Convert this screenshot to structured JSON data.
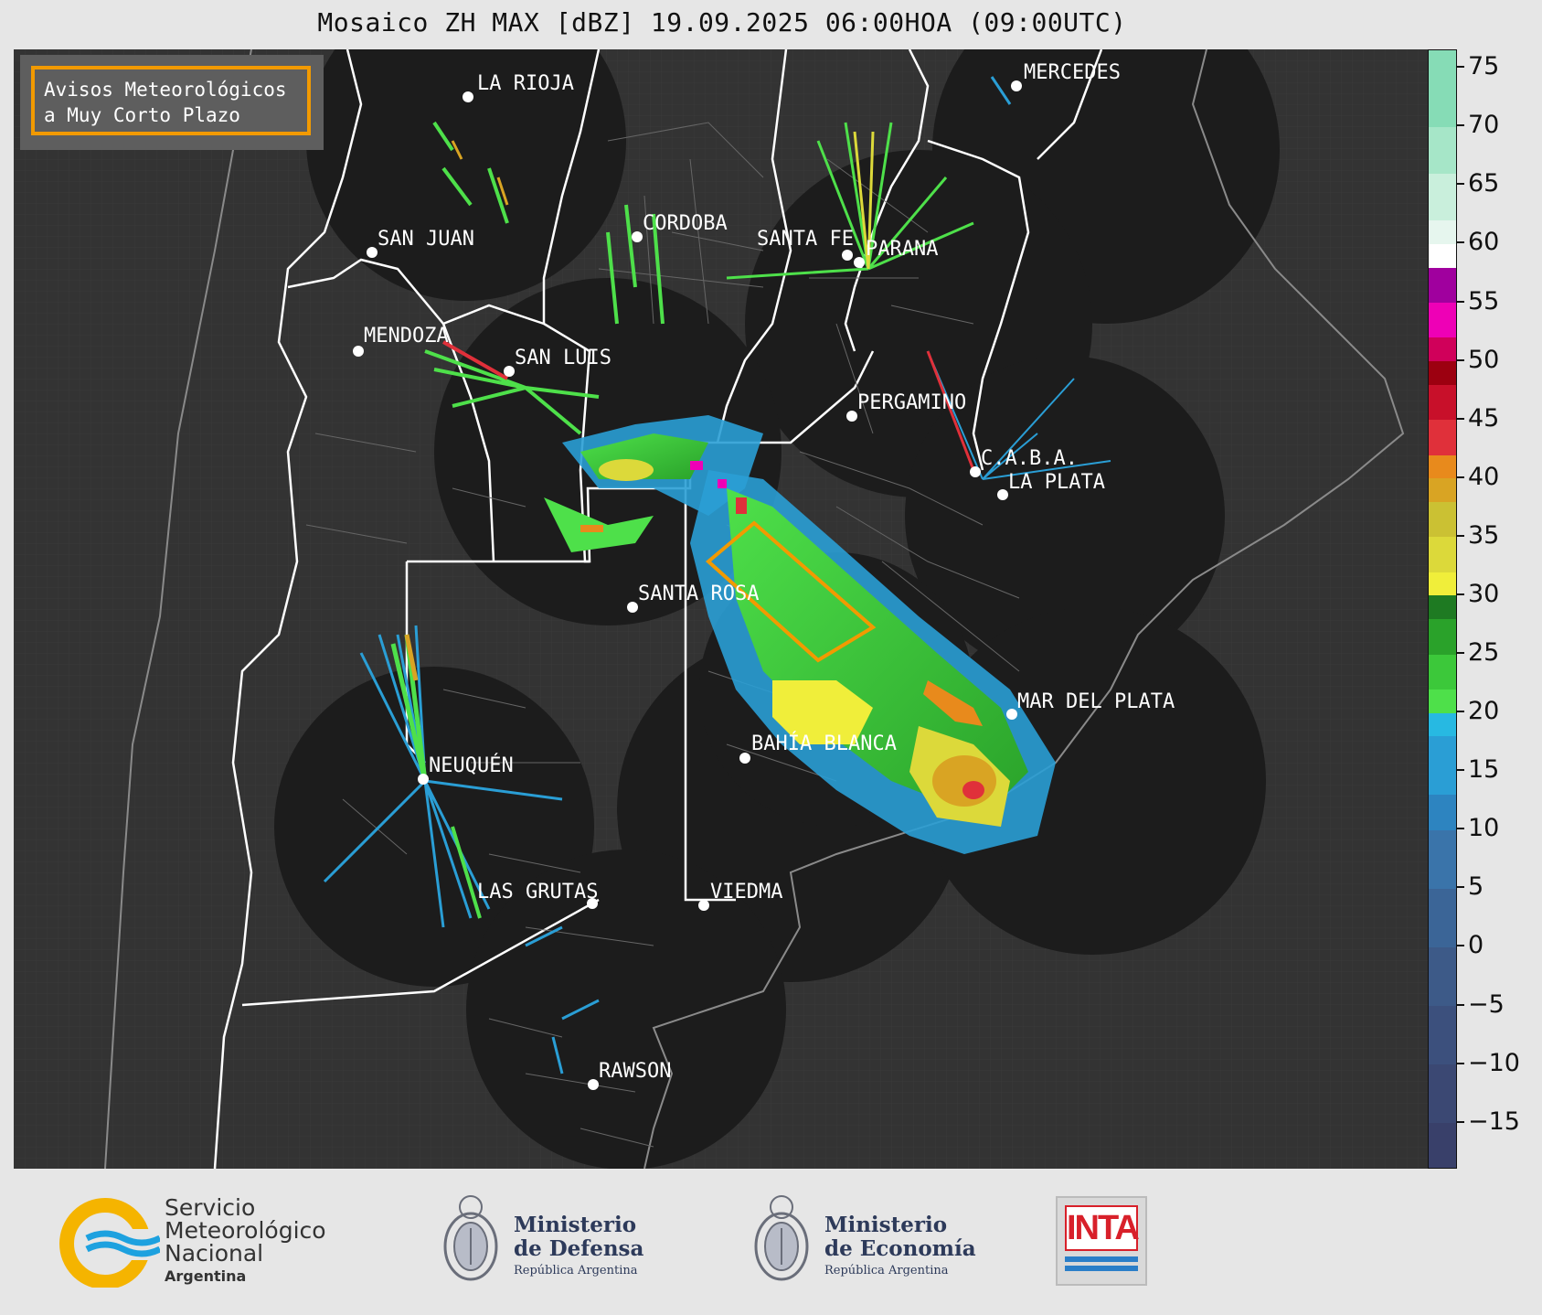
{
  "title": "Mosaico ZH MAX [dBZ] 19.09.2025 06:00HOA (09:00UTC)",
  "legend_box": {
    "line1": "Avisos Meteorológicos",
    "line2": "a Muy Corto Plazo"
  },
  "cities": [
    {
      "name": "LA RIOJA"
    },
    {
      "name": "MERCEDES"
    },
    {
      "name": "SAN JUAN"
    },
    {
      "name": "CORDOBA"
    },
    {
      "name": "SANTA FE"
    },
    {
      "name": "PARANA"
    },
    {
      "name": "MENDOZA"
    },
    {
      "name": "SAN LUIS"
    },
    {
      "name": "PERGAMINO"
    },
    {
      "name": "C.A.B.A."
    },
    {
      "name": "LA PLATA"
    },
    {
      "name": "SANTA ROSA"
    },
    {
      "name": "MAR DEL PLATA"
    },
    {
      "name": "BAHÍA BLANCA"
    },
    {
      "name": "NEUQUÉN"
    },
    {
      "name": "LAS GRUTAS"
    },
    {
      "name": "VIEDMA"
    },
    {
      "name": "RAWSON"
    }
  ],
  "colorbar": {
    "unit": "dBZ",
    "min": -19,
    "max": 76.5,
    "tick_labels": [
      "75",
      "70",
      "65",
      "60",
      "55",
      "50",
      "45",
      "40",
      "35",
      "30",
      "25",
      "20",
      "15",
      "10",
      "5",
      "0",
      "−5",
      "−10",
      "−15"
    ],
    "tick_values": [
      75,
      70,
      65,
      60,
      55,
      50,
      45,
      40,
      35,
      30,
      25,
      20,
      15,
      10,
      5,
      0,
      -5,
      -10,
      -15
    ],
    "bands": [
      {
        "from": -19,
        "to": -15,
        "color": "#39406a"
      },
      {
        "from": -15,
        "to": -10,
        "color": "#3b4873"
      },
      {
        "from": -10,
        "to": -5,
        "color": "#3c507d"
      },
      {
        "from": -5,
        "to": 0,
        "color": "#3d5a88"
      },
      {
        "from": 0,
        "to": 5,
        "color": "#3b6597"
      },
      {
        "from": 5,
        "to": 10,
        "color": "#3a74aa"
      },
      {
        "from": 10,
        "to": 13,
        "color": "#2d84c0"
      },
      {
        "from": 13,
        "to": 18,
        "color": "#2a9ed5"
      },
      {
        "from": 18,
        "to": 20,
        "color": "#27b9e2"
      },
      {
        "from": 20,
        "to": 22,
        "color": "#4ee04a"
      },
      {
        "from": 22,
        "to": 25,
        "color": "#3cc83a"
      },
      {
        "from": 25,
        "to": 28,
        "color": "#2aa22a"
      },
      {
        "from": 28,
        "to": 30,
        "color": "#1e7a22"
      },
      {
        "from": 30,
        "to": 32,
        "color": "#f0ee3a"
      },
      {
        "from": 32,
        "to": 35,
        "color": "#dcd93a"
      },
      {
        "from": 35,
        "to": 38,
        "color": "#cbc133"
      },
      {
        "from": 38,
        "to": 40,
        "color": "#d9a423"
      },
      {
        "from": 40,
        "to": 42,
        "color": "#e88a1c"
      },
      {
        "from": 42,
        "to": 45,
        "color": "#e0303a"
      },
      {
        "from": 45,
        "to": 48,
        "color": "#c8102a"
      },
      {
        "from": 48,
        "to": 50,
        "color": "#9c0010"
      },
      {
        "from": 50,
        "to": 52,
        "color": "#d0005a"
      },
      {
        "from": 52,
        "to": 55,
        "color": "#ee00b6"
      },
      {
        "from": 55,
        "to": 58,
        "color": "#a0009e"
      },
      {
        "from": 58,
        "to": 60,
        "color": "#ffffff"
      },
      {
        "from": 60,
        "to": 62,
        "color": "#e6f6ee"
      },
      {
        "from": 62,
        "to": 66,
        "color": "#c9efdc"
      },
      {
        "from": 66,
        "to": 70,
        "color": "#a6e6c8"
      },
      {
        "from": 70,
        "to": 76.5,
        "color": "#86dcb6"
      }
    ]
  },
  "footer": {
    "smn": {
      "line1": "Servicio",
      "line2": "Meteorológico",
      "line3": "Nacional",
      "line4": "Argentina"
    },
    "defensa": {
      "line1": "Ministerio",
      "line2": "de Defensa",
      "line3": "República Argentina"
    },
    "economia": {
      "line1": "Ministerio",
      "line2": "de Economía",
      "line3": "República Argentina"
    },
    "inta": {
      "text": "INTA"
    }
  },
  "colors": {
    "radar_coverage": "#1c1c1c",
    "land": "#333333",
    "warning_polygon": "#f29a00",
    "province_border": "#ffffff"
  }
}
